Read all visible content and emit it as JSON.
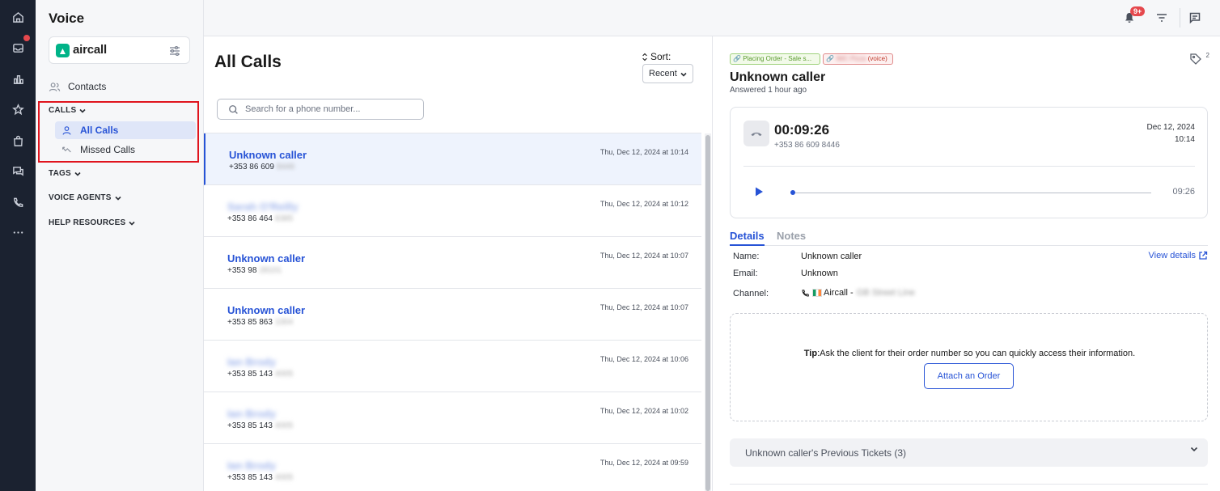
{
  "sidebar": {
    "title": "Voice",
    "brand": "aircall",
    "contacts_label": "Contacts",
    "sections": {
      "calls": "CALLS",
      "tags": "TAGS",
      "voice_agents": "VOICE AGENTS",
      "help_resources": "HELP RESOURCES"
    },
    "calls_items": [
      {
        "label": "All Calls",
        "active": true
      },
      {
        "label": "Missed Calls",
        "active": false
      }
    ]
  },
  "topbar": {
    "notification_badge": "9+"
  },
  "call_list": {
    "title": "All Calls",
    "sort_label": "Sort:",
    "sort_value": "Recent",
    "search_placeholder": "Search for a phone number...",
    "rows": [
      {
        "name": "Unknown caller",
        "phone": "+353 86 609",
        "phone_hidden": "8446",
        "time": "Thu, Dec 12, 2024 at 10:14",
        "blurred_name": false,
        "selected": true
      },
      {
        "name": "Sarah O'Reilly",
        "phone": "+353 86 464",
        "phone_hidden": "8385",
        "time": "Thu, Dec 12, 2024 at 10:12",
        "blurred_name": true,
        "selected": false
      },
      {
        "name": "Unknown caller",
        "phone": "+353 98",
        "phone_hidden": "28101",
        "time": "Thu, Dec 12, 2024 at 10:07",
        "blurred_name": false,
        "selected": false
      },
      {
        "name": "Unknown caller",
        "phone": "+353 85 863",
        "phone_hidden": "1004",
        "time": "Thu, Dec 12, 2024 at 10:07",
        "blurred_name": false,
        "selected": false
      },
      {
        "name": "Ian Brody",
        "phone": "+353 85 143",
        "phone_hidden": "4005",
        "time": "Thu, Dec 12, 2024 at 10:06",
        "blurred_name": true,
        "selected": false
      },
      {
        "name": "Ian Brody",
        "phone": "+353 85 143",
        "phone_hidden": "4005",
        "time": "Thu, Dec 12, 2024 at 10:02",
        "blurred_name": true,
        "selected": false
      },
      {
        "name": "Ian Brody",
        "phone": "+353 85 143",
        "phone_hidden": "4005",
        "time": "Thu, Dec 12, 2024 at 09:59",
        "blurred_name": true,
        "selected": false
      }
    ]
  },
  "detail": {
    "tag_green": "Placing Order - Sale s...",
    "tag_red_hidden": "IWC Pizza",
    "tag_red_suffix": "(voice)",
    "tag_count": "2",
    "caller": "Unknown caller",
    "subtitle": "Answered 1 hour ago",
    "duration": "00:09:26",
    "phone": "+353 86 609 8446",
    "date": "Dec 12, 2024",
    "time": "10:14",
    "audio_time": "09:26",
    "tabs": [
      "Details",
      "Notes"
    ],
    "fields": {
      "name_label": "Name:",
      "name_value": "Unknown caller",
      "email_label": "Email:",
      "email_value": "Unknown",
      "channel_label": "Channel:",
      "channel_value": "Aircall -",
      "channel_hidden": "GB Street Line"
    },
    "view_details": "View details",
    "tip_label": "Tip",
    "tip_text": ":Ask the client for their order number so you can quickly access their information.",
    "attach_button": "Attach an Order",
    "previous_tickets": "Unknown caller's Previous Tickets (3)"
  }
}
